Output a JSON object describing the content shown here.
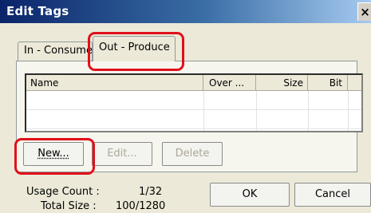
{
  "window": {
    "title": "Edit Tags",
    "close_label": "×"
  },
  "tabs": [
    {
      "label": "In - Consume",
      "selected": false
    },
    {
      "label": "Out - Produce",
      "selected": true
    }
  ],
  "table": {
    "columns": [
      "Name",
      "Over ...",
      "Size",
      "Bit"
    ],
    "rows": []
  },
  "buttons": {
    "new": "New...",
    "edit": "Edit...",
    "delete": "Delete",
    "ok": "OK",
    "cancel": "Cancel"
  },
  "stats": {
    "usage_label": "Usage Count :",
    "usage_value": "1/32",
    "size_label": "Total Size :",
    "size_value": "100/1280"
  },
  "colors": {
    "highlight": "#e0101a",
    "titlebar_start": "#0a246a"
  }
}
